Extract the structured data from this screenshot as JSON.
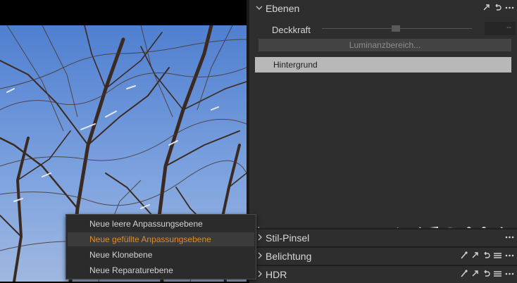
{
  "layers_panel": {
    "title": "Ebenen",
    "opacity_label": "Deckkraft",
    "opacity_value": "--",
    "luminance_button": "Luminanzbereich...",
    "layers": [
      {
        "name": "Hintergrund",
        "selected": true
      }
    ],
    "add_label": "+.",
    "remove_label": "−"
  },
  "context_menu": {
    "items": [
      {
        "label": "Neue leere Anpassungsebene",
        "highlighted": false
      },
      {
        "label": "Neue gefüllte Anpassungsebene",
        "highlighted": true
      },
      {
        "label": "Neue Klonebene",
        "highlighted": false
      },
      {
        "label": "Neue Reparaturebene",
        "highlighted": false
      }
    ]
  },
  "tools": {
    "stil_pinsel": {
      "title": "Stil-Pinsel"
    },
    "belichtung": {
      "title": "Belichtung"
    },
    "hdr": {
      "title": "HDR"
    }
  },
  "colors": {
    "panel_bg": "#2e2e2e",
    "selected_layer": "#b8b8b8",
    "menu_highlight_text": "#e0892b",
    "sky_blue": "#5b86c9"
  },
  "icons": {
    "header": [
      "collapse-chevron-icon",
      "popout-icon",
      "reset-icon",
      "more-icon"
    ],
    "layer_tools": [
      "eye-icon",
      "swap-icon",
      "brush-icon",
      "gradient-icon",
      "radial-icon",
      "heal-icon",
      "stamp-icon",
      "eraser-icon"
    ],
    "tool_headers": [
      "picker-icon",
      "popout-icon",
      "reset-icon",
      "list-icon",
      "more-icon"
    ]
  }
}
